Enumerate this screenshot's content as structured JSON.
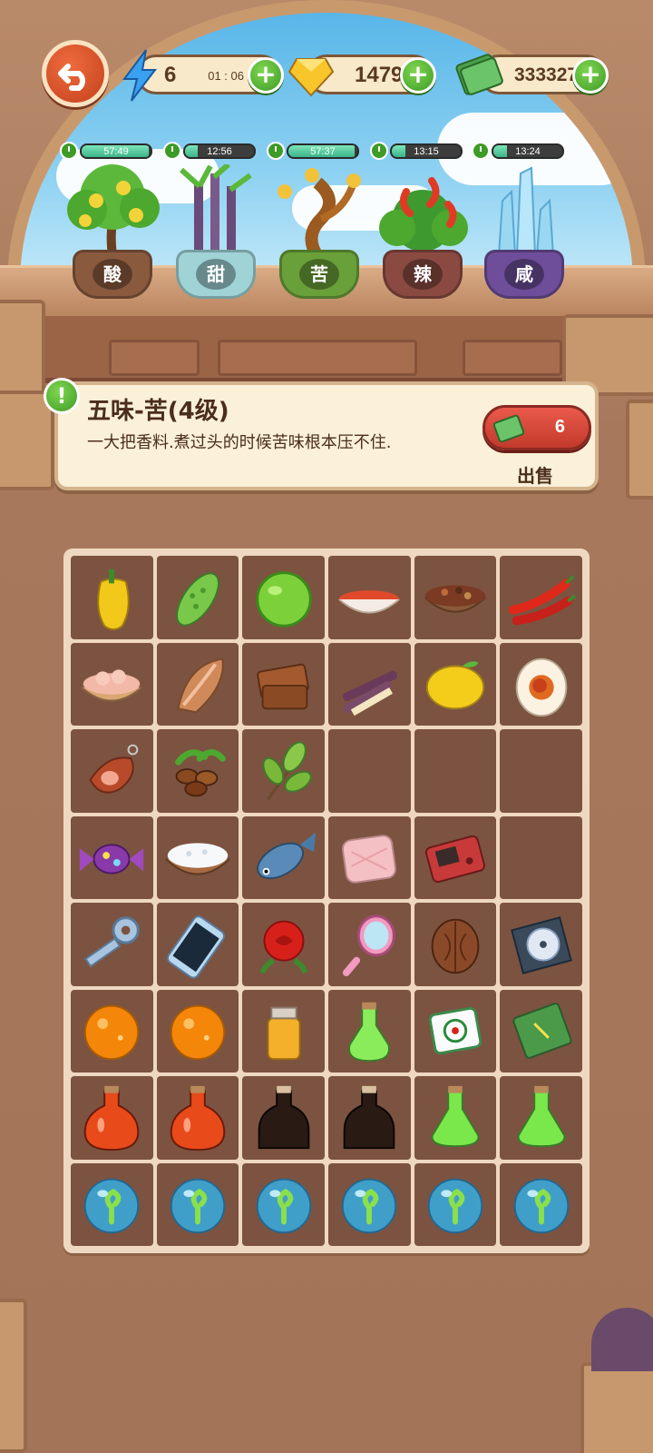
{
  "resources": {
    "energy": {
      "value": "6",
      "timer": "01 : 06",
      "icon": "lightning-icon"
    },
    "gems": {
      "value": "1479",
      "icon": "gem-icon"
    },
    "cash": {
      "value": "333327",
      "icon": "cash-icon"
    }
  },
  "plants": [
    {
      "timer": "57:49",
      "label": "酸",
      "progress": 0.97,
      "pot_color": "#8a5a3e",
      "kind": "lemon-tree"
    },
    {
      "timer": "12:56",
      "label": "甜",
      "progress": 0.18,
      "pot_color": "#9fd3d6",
      "kind": "sugarcane"
    },
    {
      "timer": "57:37",
      "label": "苦",
      "progress": 0.96,
      "pot_color": "#6aa03a",
      "kind": "bitter-tree"
    },
    {
      "timer": "13:15",
      "label": "辣",
      "progress": 0.2,
      "pot_color": "#8a4a42",
      "kind": "chili-plant"
    },
    {
      "timer": "13:24",
      "label": "咸",
      "progress": 0.2,
      "pot_color": "#6e4e9a",
      "kind": "salt-crystal"
    }
  ],
  "info": {
    "title": "五味-苦(4级)",
    "description": "一大把香料.煮过头的时候苦味根本压不住.",
    "sell_price": "6",
    "sell_label": "出售"
  },
  "grid": [
    [
      "yellow-pepper",
      "bitter-melon",
      "lime",
      "chili-powder-bowl",
      "spice-bowl",
      "red-chilies"
    ],
    [
      "meat-bowl",
      "smoked-fish",
      "brown-sugar-block",
      "sugarcane-sticks",
      "lemon",
      "salted-egg"
    ],
    [
      "ham-leg",
      "coffee-beans",
      "tea-leaves",
      "",
      "",
      ""
    ],
    [
      "candy",
      "salt-bowl",
      "fish",
      "pink-pillow",
      "game-console",
      ""
    ],
    [
      "key",
      "smartphone",
      "rose",
      "hand-mirror",
      "walnut",
      "cd-case"
    ],
    [
      "orange-gem",
      "orange-gem",
      "honey-jar",
      "green-potion-small",
      "mahjong-tile",
      "green-notebook"
    ],
    [
      "red-potion",
      "red-potion",
      "soy-sauce-bottle",
      "soy-sauce-bottle",
      "green-potion",
      "green-potion"
    ],
    [
      "sprout-bubble",
      "sprout-bubble",
      "sprout-bubble",
      "sprout-bubble",
      "sprout-bubble",
      "sprout-bubble"
    ]
  ],
  "colors": {
    "accent_green": "#3e9b26",
    "sell_red": "#c23a2c",
    "back_orange": "#d9532a"
  }
}
